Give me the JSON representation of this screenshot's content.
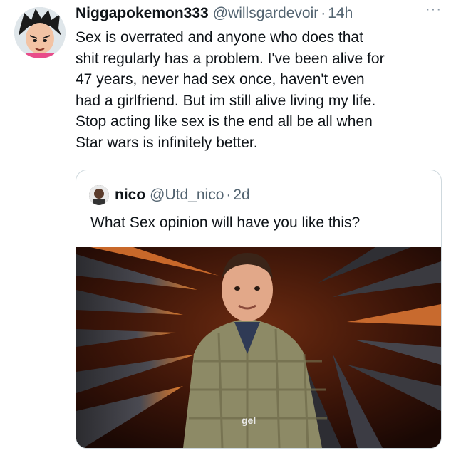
{
  "tweet": {
    "display_name": "Niggapokemon333",
    "handle": "@willsgardevoir",
    "separator": "·",
    "time": "14h",
    "more_label": "···",
    "text": "Sex is overrated and anyone who does that\nshit regularly has a problem. I've been alive for\n47 years, never had sex once, haven't even\nhad a girlfriend. But im still alive living my life.\nStop acting like sex is the end all be all when\nStar wars is infinitely better."
  },
  "quote": {
    "display_name": "nico",
    "handle": "@Utd_nico",
    "separator": "·",
    "time": "2d",
    "text": "What Sex opinion will have you like this?",
    "media_caption_partial": "gel"
  },
  "colors": {
    "text_primary": "#0f1419",
    "text_secondary": "#536471",
    "border": "#cfd9de"
  }
}
